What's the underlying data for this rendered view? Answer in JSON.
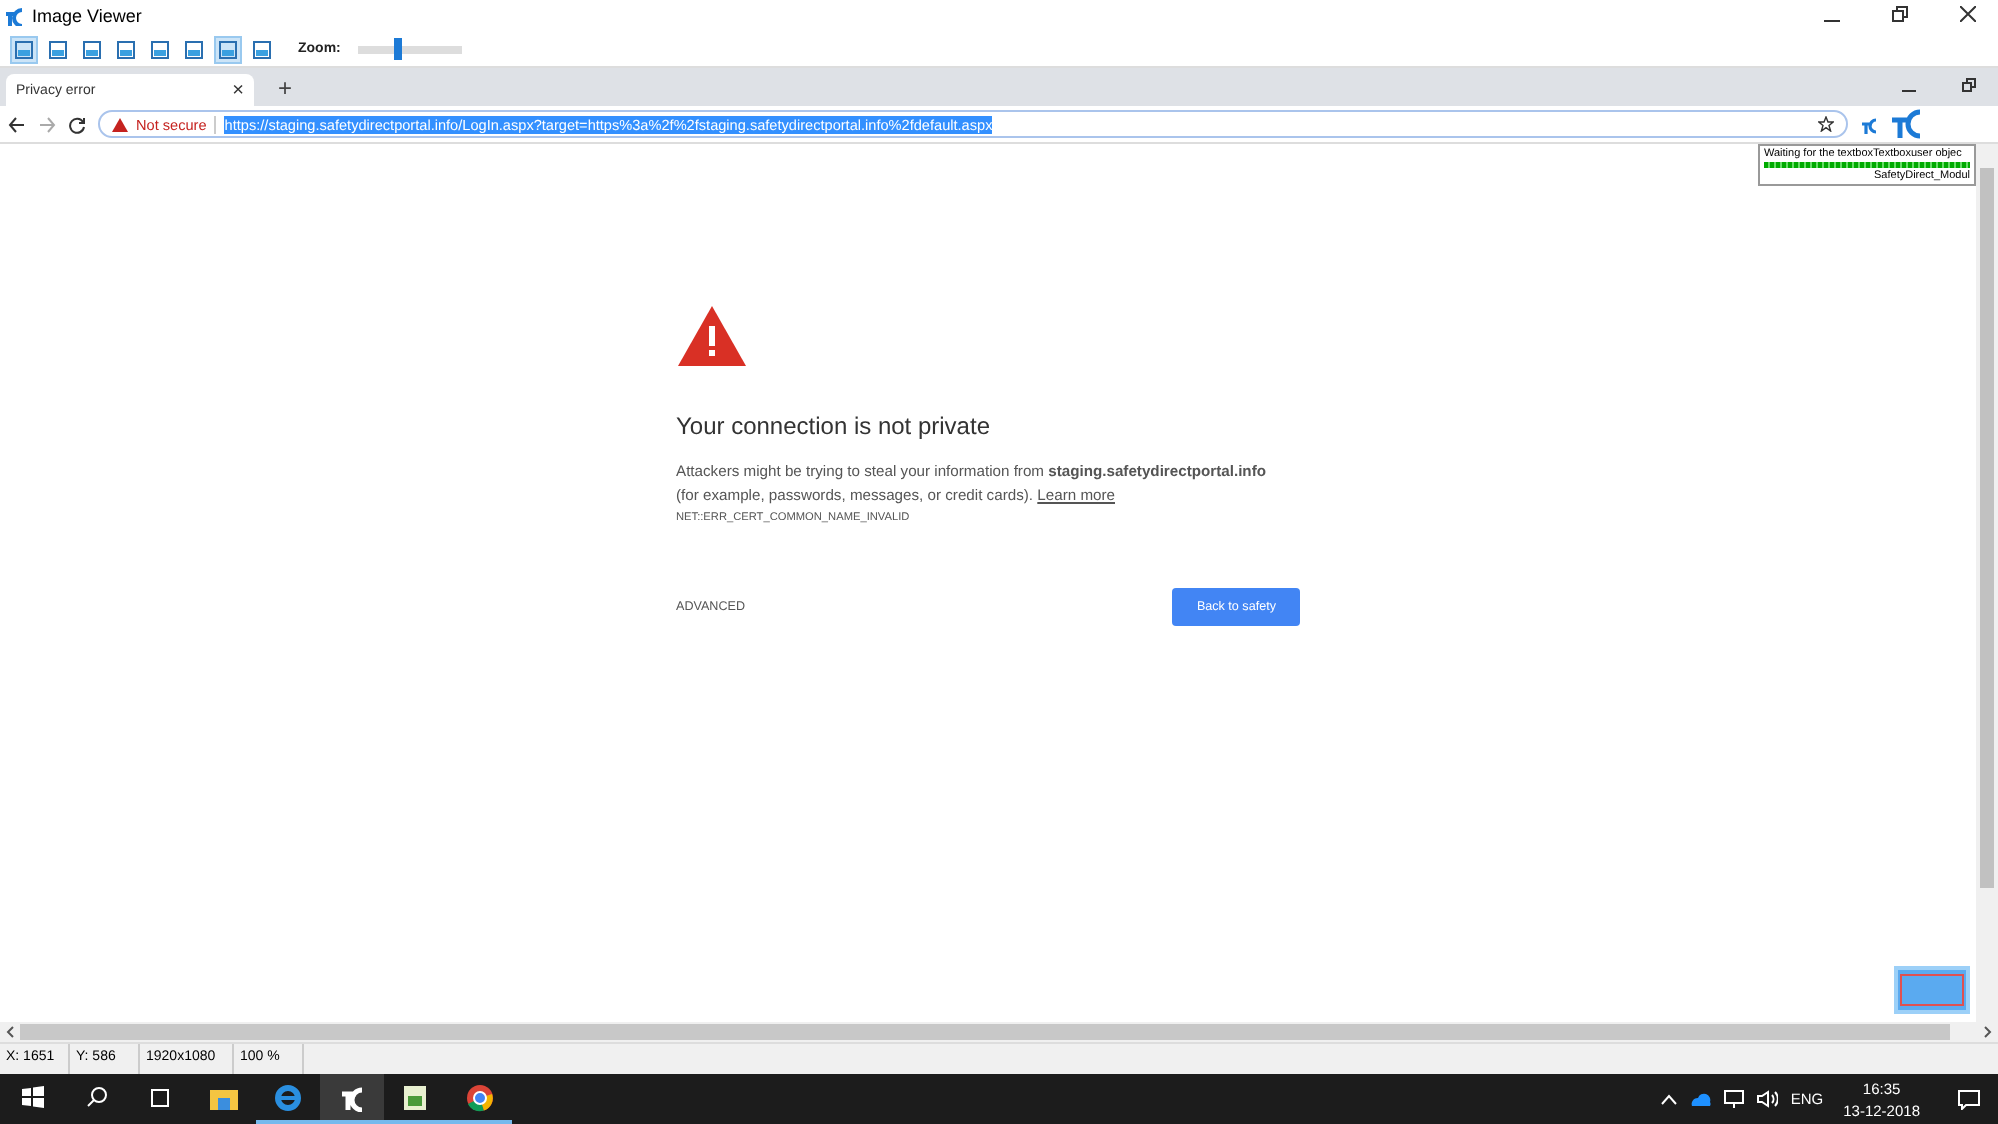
{
  "window": {
    "title": "Image Viewer"
  },
  "toolbar": {
    "buttons": [
      {
        "selected": true
      },
      {
        "selected": false
      },
      {
        "selected": false
      },
      {
        "selected": false
      },
      {
        "selected": false
      },
      {
        "selected": false
      },
      {
        "selected": true
      },
      {
        "selected": false
      }
    ],
    "zoom_label": "Zoom:",
    "zoom": {
      "level": 0.38
    }
  },
  "browser": {
    "tab": {
      "title": "Privacy error",
      "close": "×"
    },
    "new_tab": "+",
    "security": "Not secure",
    "url": "https://staging.safetydirectportal.info/LogIn.aspx?target=https%3a%2f%2fstaging.safetydirectportal.info%2fdefault.aspx",
    "popup": {
      "message": "Waiting for the textboxTextboxuser objec",
      "progress": {
        "level": 1
      },
      "caption": "SafetyDirect_Modul"
    },
    "page": {
      "heading": "Your connection is not private",
      "body": "Attackers might be trying to steal your information from **staging.safetydirectportal.info**",
      "body2": "(for example, passwords, messages, or credit cards).",
      "link": "Learn more",
      "error_code": "NET::ERR_CERT_COMMON_NAME_INVALID",
      "advanced": "ADVANCED",
      "back_button": "Back to safety"
    }
  },
  "status_bar": [
    "X: 1651",
    "Y: 586",
    "1920x1080",
    "100 %"
  ],
  "taskbar": {
    "apps": [
      {
        "kind": "explorer",
        "running": false,
        "selected": false
      },
      {
        "kind": "ie",
        "running": true,
        "selected": false
      },
      {
        "kind": "viewer",
        "running": true,
        "selected": true
      },
      {
        "kind": "notepad",
        "running": true,
        "selected": false
      },
      {
        "kind": "chrome",
        "running": true,
        "selected": false
      }
    ],
    "language": "ENG",
    "time": "16:35",
    "date": "13-12-2018"
  }
}
